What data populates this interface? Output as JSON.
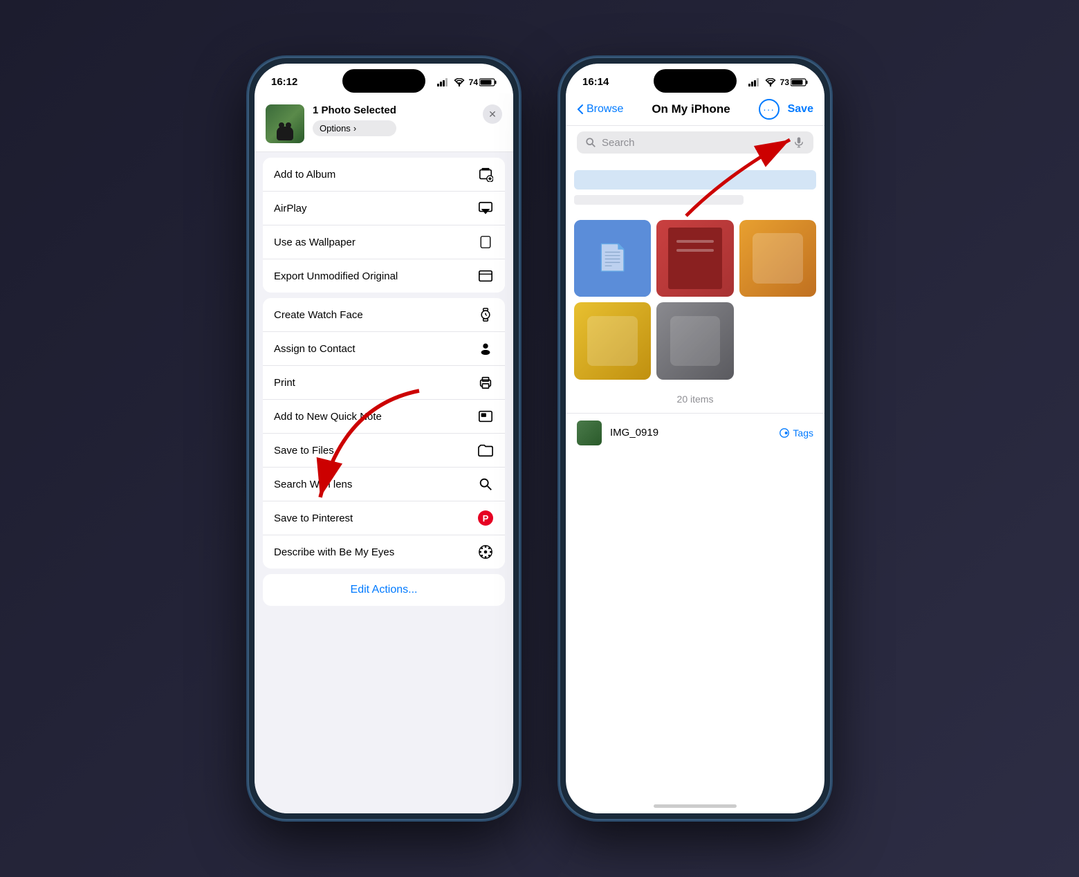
{
  "left_phone": {
    "status_bar": {
      "time": "16:12",
      "battery": "74"
    },
    "share_header": {
      "title": "1 Photo Selected",
      "options_label": "Options",
      "options_arrow": "›"
    },
    "menu_sections": [
      {
        "id": "section1",
        "items": [
          {
            "label": "Add to Album",
            "icon": "⊞",
            "icon_type": "add-album"
          },
          {
            "label": "AirPlay",
            "icon": "▲",
            "icon_type": "airplay"
          },
          {
            "label": "Use as Wallpaper",
            "icon": "📱",
            "icon_type": "wallpaper"
          },
          {
            "label": "Export Unmodified Original",
            "icon": "🗂",
            "icon_type": "export"
          }
        ]
      },
      {
        "id": "section2",
        "items": [
          {
            "label": "Create Watch Face",
            "icon": "⌚",
            "icon_type": "watch"
          },
          {
            "label": "Assign to Contact",
            "icon": "👤",
            "icon_type": "contact"
          },
          {
            "label": "Print",
            "icon": "🖨",
            "icon_type": "print"
          },
          {
            "label": "Add to New Quick Note",
            "icon": "🖼",
            "icon_type": "note"
          },
          {
            "label": "Save to Files",
            "icon": "📁",
            "icon_type": "files"
          },
          {
            "label": "Search With lens",
            "icon": "🔍",
            "icon_type": "search"
          },
          {
            "label": "Save to Pinterest",
            "icon": "P",
            "icon_type": "pinterest"
          },
          {
            "label": "Describe with Be My Eyes",
            "icon": "✳",
            "icon_type": "eyes"
          }
        ]
      }
    ],
    "edit_actions": "Edit Actions..."
  },
  "right_phone": {
    "status_bar": {
      "time": "16:14",
      "battery": "73"
    },
    "nav": {
      "back_label": "Browse",
      "title": "On My iPhone",
      "save_label": "Save"
    },
    "search": {
      "placeholder": "Search"
    },
    "files_count": "20 items",
    "bottom_file": {
      "name": "IMG_0919",
      "tags_label": "Tags"
    }
  },
  "icons": {
    "close": "✕",
    "chevron_left": "‹",
    "more_dots": "•••",
    "microphone": "🎙",
    "tag": "🏷"
  }
}
